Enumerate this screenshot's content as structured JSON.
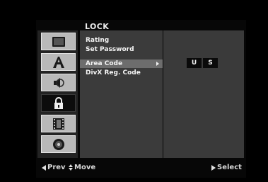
{
  "title": "LOCK",
  "sidebar": {
    "icons": [
      {
        "name": "display-icon"
      },
      {
        "name": "language-icon"
      },
      {
        "name": "audio-icon"
      },
      {
        "name": "lock-icon",
        "active": true
      },
      {
        "name": "film-icon"
      },
      {
        "name": "disc-icon"
      }
    ]
  },
  "menu": {
    "items": [
      {
        "label": "Rating"
      },
      {
        "label": "Set Password"
      },
      {
        "label": "Area Code",
        "selected": true
      },
      {
        "label": "DivX Reg. Code"
      }
    ]
  },
  "area_code": {
    "chars": [
      "U",
      "S"
    ]
  },
  "footer": {
    "prev_label": "Prev",
    "move_label": "Move",
    "select_label": "Select"
  }
}
